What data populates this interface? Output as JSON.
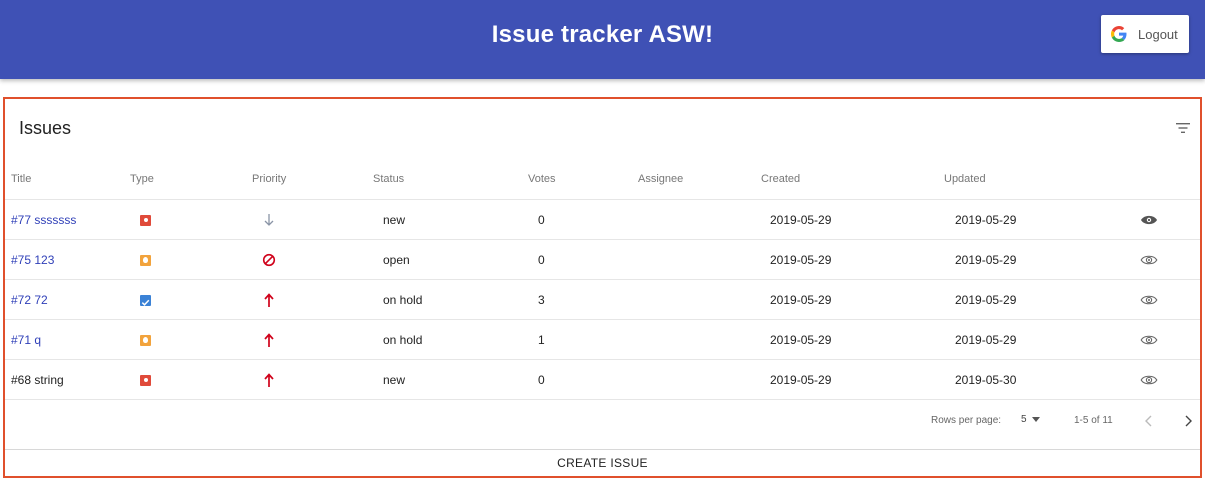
{
  "header": {
    "title": "Issue tracker ASW!",
    "logout_label": "Logout",
    "login_provider_icon": "google-g-icon",
    "bar_color": "#3f51b5"
  },
  "panel": {
    "title": "Issues",
    "filter_icon": "filter-list-icon",
    "border_color": "#e0502c"
  },
  "columns": [
    "Title",
    "Type",
    "Priority",
    "Status",
    "Votes",
    "Assignee",
    "Created",
    "Updated"
  ],
  "issues": [
    {
      "title": "#77 sssssss",
      "linked": true,
      "type": "bug",
      "priority": "trivial",
      "status": "new",
      "votes": "0",
      "assignee": "",
      "created": "2019-05-29",
      "updated": "2019-05-29",
      "watching": true
    },
    {
      "title": "#75 123",
      "linked": true,
      "type": "enhancement",
      "priority": "blocker",
      "status": "open",
      "votes": "0",
      "assignee": "",
      "created": "2019-05-29",
      "updated": "2019-05-29",
      "watching": false
    },
    {
      "title": "#72 72",
      "linked": true,
      "type": "task",
      "priority": "critical",
      "status": "on hold",
      "votes": "3",
      "assignee": "",
      "created": "2019-05-29",
      "updated": "2019-05-29",
      "watching": false
    },
    {
      "title": "#71 q",
      "linked": true,
      "type": "enhancement",
      "priority": "critical",
      "status": "on hold",
      "votes": "1",
      "assignee": "",
      "created": "2019-05-29",
      "updated": "2019-05-29",
      "watching": false
    },
    {
      "title": "#68 string",
      "linked": false,
      "type": "bug",
      "priority": "critical",
      "status": "new",
      "votes": "0",
      "assignee": "",
      "created": "2019-05-29",
      "updated": "2019-05-30",
      "watching": false
    }
  ],
  "pagination": {
    "rows_per_page_label": "Rows per page:",
    "rows_per_page_value": "5",
    "range_label": "1-5 of 11",
    "prev_icon": "chevron-left-icon",
    "next_icon": "chevron-right-icon"
  },
  "create_button_label": "CREATE ISSUE",
  "colors": {
    "link": "#3040b8",
    "bug": "#e04a3a",
    "enhancement": "#f2a33c",
    "task": "#3b82d6",
    "priority_up": "#d0021b",
    "priority_blocker": "#d0021b",
    "priority_trivial": "#8a94a6"
  }
}
